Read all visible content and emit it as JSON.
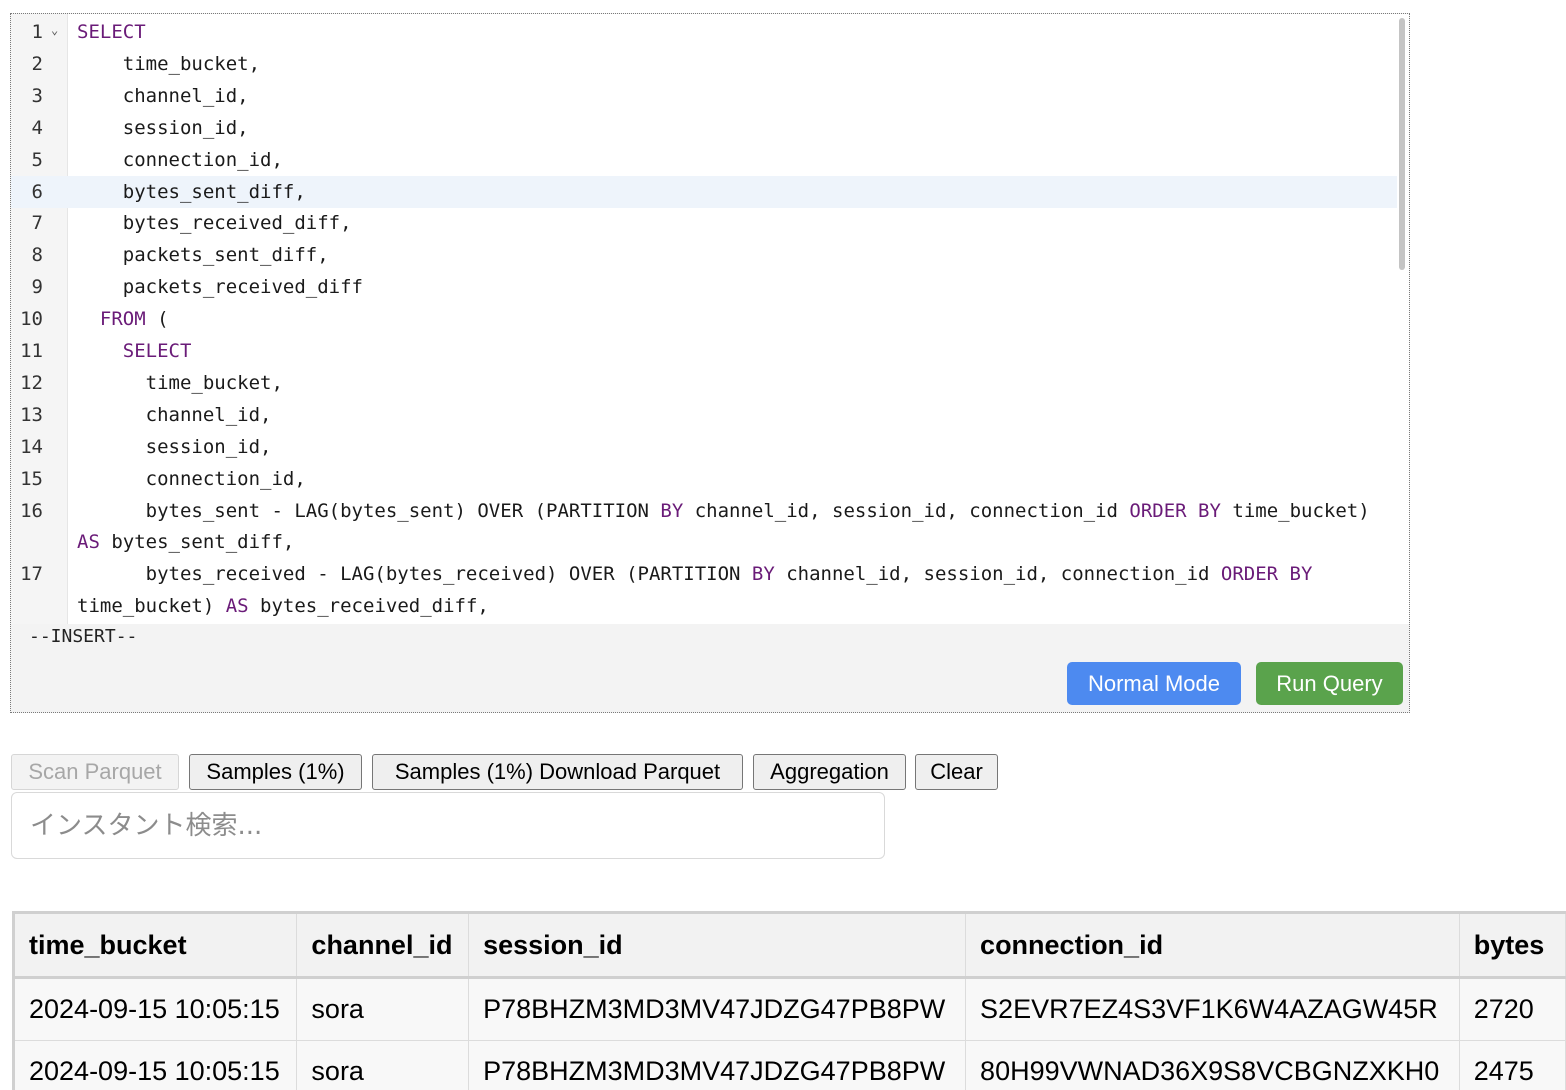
{
  "editor": {
    "lines": [
      {
        "num": "1",
        "fold": "⌄",
        "indent": "",
        "tokens": [
          {
            "k": true,
            "t": "SELECT"
          }
        ]
      },
      {
        "num": "2",
        "indent": "    ",
        "tokens": [
          {
            "t": "time_bucket,"
          }
        ]
      },
      {
        "num": "3",
        "indent": "    ",
        "tokens": [
          {
            "t": "channel_id,"
          }
        ]
      },
      {
        "num": "4",
        "indent": "    ",
        "tokens": [
          {
            "t": "session_id,"
          }
        ]
      },
      {
        "num": "5",
        "indent": "    ",
        "tokens": [
          {
            "t": "connection_id,"
          }
        ]
      },
      {
        "num": "6",
        "indent": "    ",
        "active": true,
        "tokens": [
          {
            "t": "bytes_sent_diff,"
          }
        ]
      },
      {
        "num": "7",
        "indent": "    ",
        "tokens": [
          {
            "t": "bytes_received_diff,"
          }
        ]
      },
      {
        "num": "8",
        "indent": "    ",
        "tokens": [
          {
            "t": "packets_sent_diff,"
          }
        ]
      },
      {
        "num": "9",
        "indent": "    ",
        "tokens": [
          {
            "t": "packets_received_diff"
          }
        ]
      },
      {
        "num": "10",
        "indent": "  ",
        "tokens": [
          {
            "k": true,
            "t": "FROM"
          },
          {
            "t": " ("
          }
        ]
      },
      {
        "num": "11",
        "indent": "    ",
        "tokens": [
          {
            "k": true,
            "t": "SELECT"
          }
        ]
      },
      {
        "num": "12",
        "indent": "      ",
        "tokens": [
          {
            "t": "time_bucket,"
          }
        ]
      },
      {
        "num": "13",
        "indent": "      ",
        "tokens": [
          {
            "t": "channel_id,"
          }
        ]
      },
      {
        "num": "14",
        "indent": "      ",
        "tokens": [
          {
            "t": "session_id,"
          }
        ]
      },
      {
        "num": "15",
        "indent": "      ",
        "tokens": [
          {
            "t": "connection_id,"
          }
        ]
      },
      {
        "num": "16",
        "indent": "      ",
        "tokens": [
          {
            "t": "bytes_sent - LAG(bytes_sent) OVER (PARTITION "
          },
          {
            "k": true,
            "t": "BY"
          },
          {
            "t": " channel_id, session_id, connection_id "
          },
          {
            "k": true,
            "t": "ORDER BY"
          },
          {
            "t": " time_bucket)"
          }
        ]
      },
      {
        "num": "",
        "indent": "",
        "tokens": [
          {
            "k": true,
            "t": "AS"
          },
          {
            "t": " bytes_sent_diff,"
          }
        ]
      },
      {
        "num": "17",
        "indent": "      ",
        "tokens": [
          {
            "t": "bytes_received - LAG(bytes_received) OVER (PARTITION "
          },
          {
            "k": true,
            "t": "BY"
          },
          {
            "t": " channel_id, session_id, connection_id "
          },
          {
            "k": true,
            "t": "ORDER BY"
          }
        ]
      },
      {
        "num": "",
        "indent": "",
        "tokens": [
          {
            "t": "time_bucket) "
          },
          {
            "k": true,
            "t": "AS"
          },
          {
            "t": " bytes_received_diff,"
          }
        ]
      }
    ],
    "mode": "--INSERT--",
    "normal_mode_label": "Normal Mode",
    "run_query_label": "Run Query",
    "colors": {
      "keyword": "#6a1b78",
      "normal_btn": "#4d8af0",
      "run_btn": "#5aa34c"
    }
  },
  "toolbar": {
    "scan_parquet": "Scan Parquet",
    "samples": "Samples (1%)",
    "samples_download": "Samples (1%) Download Parquet",
    "aggregation": "Aggregation",
    "clear": "Clear"
  },
  "search": {
    "placeholder": "インスタント検索..."
  },
  "table": {
    "columns": [
      "time_bucket",
      "channel_id",
      "session_id",
      "connection_id",
      "bytes"
    ],
    "rows": [
      [
        "2024-09-15 10:05:15",
        "sora",
        "P78BHZM3MD3MV47JDZG47PB8PW",
        "S2EVR7EZ4S3VF1K6W4AZAGW45R",
        "2720"
      ],
      [
        "2024-09-15 10:05:15",
        "sora",
        "P78BHZM3MD3MV47JDZG47PB8PW",
        "80H99VWNAD36X9S8VCBGNZXKH0",
        "2475"
      ]
    ]
  }
}
